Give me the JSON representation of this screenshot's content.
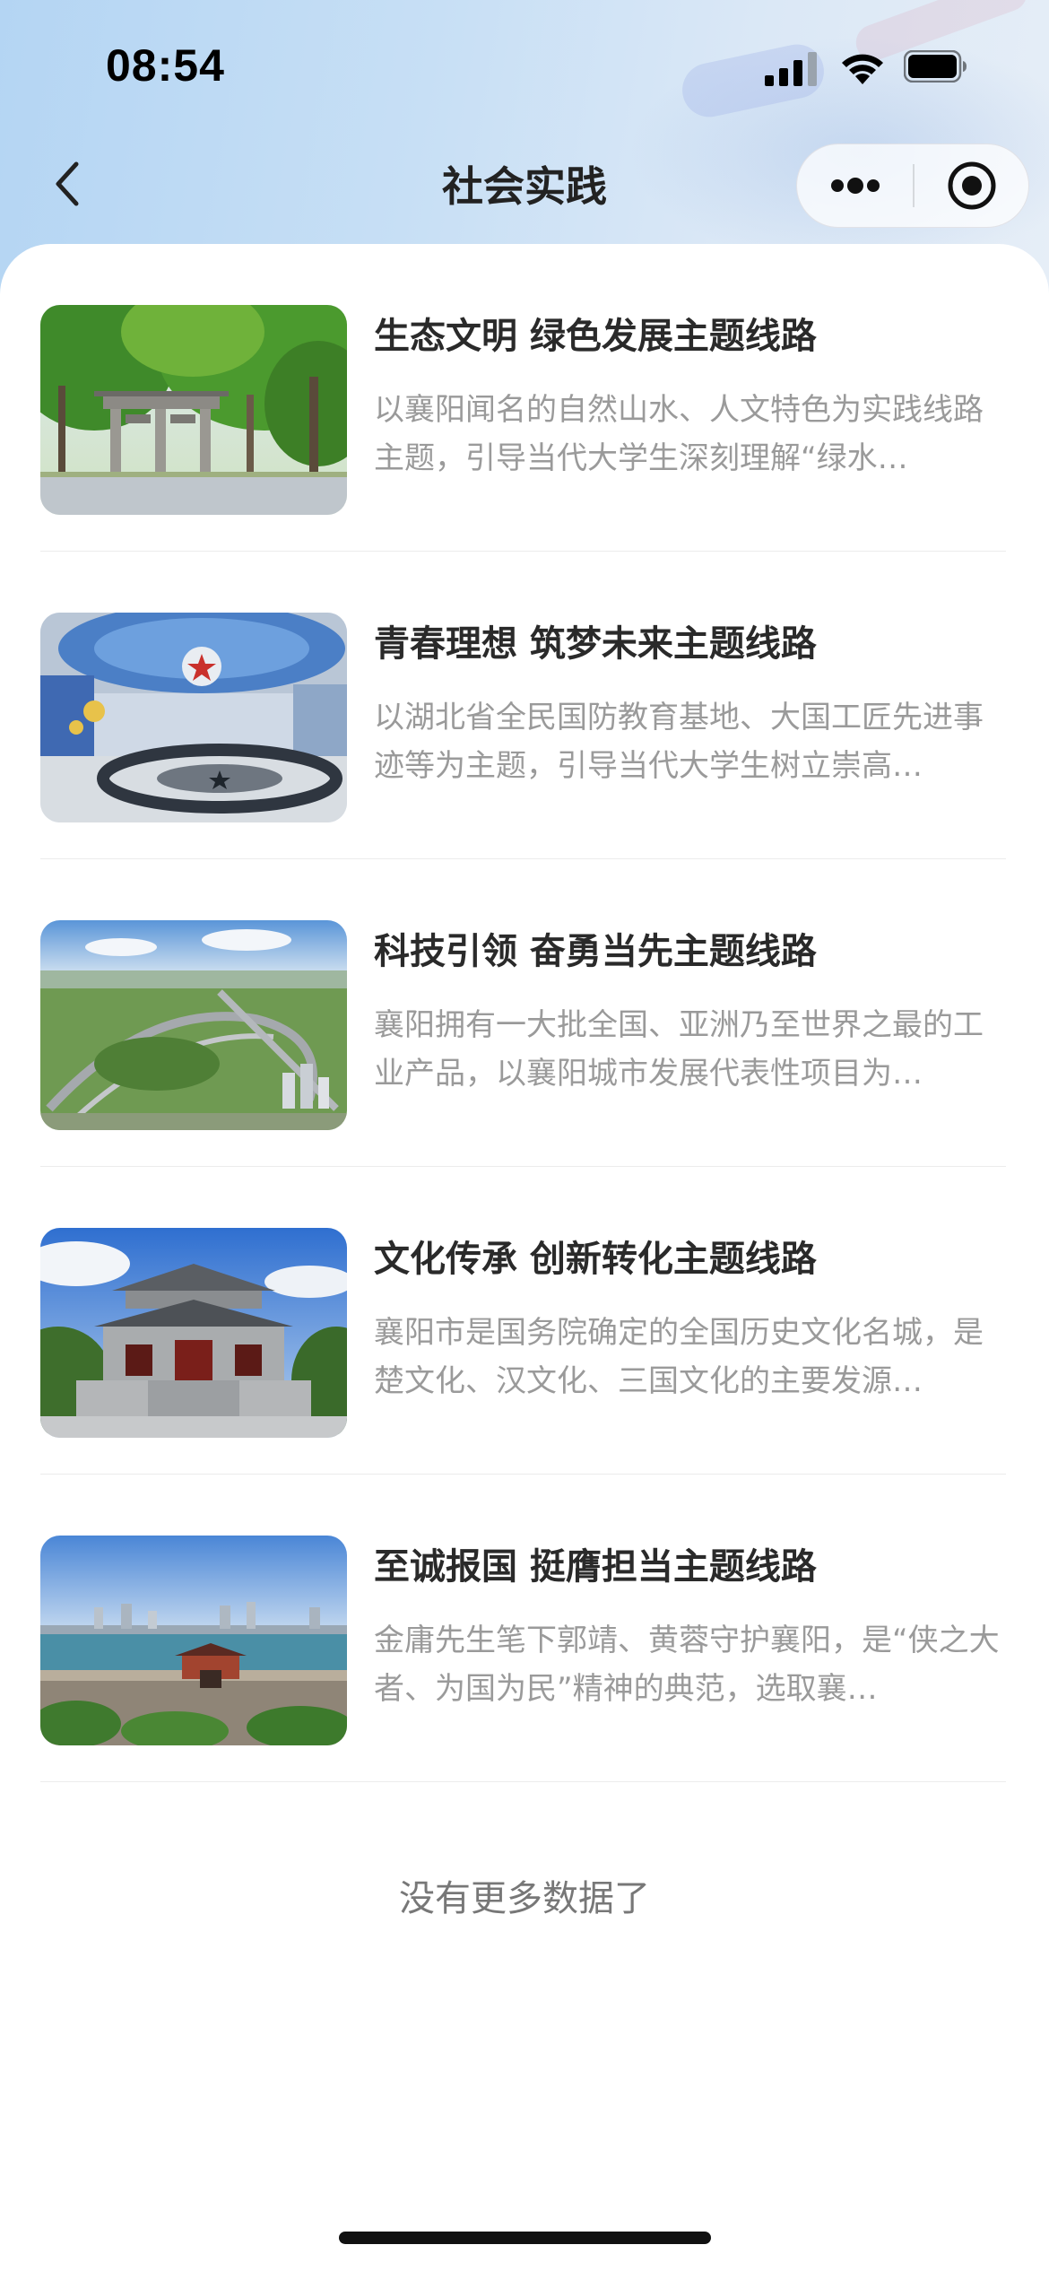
{
  "status_bar": {
    "time": "08:54"
  },
  "nav": {
    "title": "社会实践"
  },
  "items": [
    {
      "title": "生态文明 绿色发展主题线路",
      "desc": "以襄阳闻名的自然山水、人文特色为实践线路主题，引导当代大学生深刻理解“绿水…",
      "image": "park-archway-image"
    },
    {
      "title": "青春理想 筑梦未来主题线路",
      "desc": "以湖北省全民国防教育基地、大国工匠先进事迹等为主题，引导当代大学生树立崇高…",
      "image": "defense-museum-image"
    },
    {
      "title": "科技引领 奋勇当先主题线路",
      "desc": "襄阳拥有一大批全国、亚洲乃至世界之最的工业产品，以襄阳城市发展代表性项目为…",
      "image": "test-track-aerial-image"
    },
    {
      "title": "文化传承 创新转化主题线路",
      "desc": "襄阳市是国务院确定的全国历史文化名城，是楚文化、汉文化、三国文化的主要发源…",
      "image": "ancient-gate-image"
    },
    {
      "title": "至诚报国 挺膺担当主题线路",
      "desc": "金庸先生笔下郭靖、黄蓉守护襄阳，是“侠之大者、为国为民”精神的典范，选取襄…",
      "image": "city-wall-river-image"
    }
  ],
  "footer": {
    "no_more": "没有更多数据了"
  }
}
